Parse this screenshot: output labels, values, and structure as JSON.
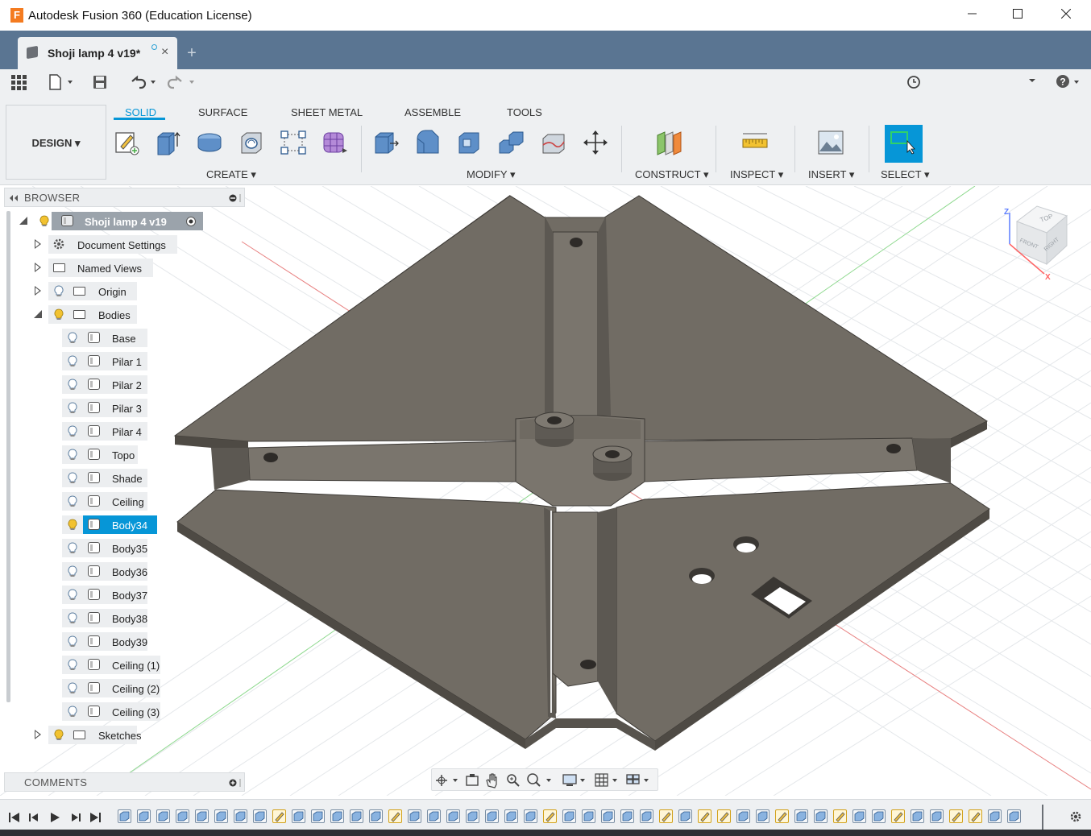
{
  "window": {
    "title": "Autodesk Fusion 360 (Education License)",
    "minimize_icon": "minimize-icon",
    "maximize_icon": "maximize-icon",
    "close_icon": "close-icon"
  },
  "document_tab": {
    "name": "Shoji lamp 4 v19*",
    "close_glyph": "×",
    "new_tab_glyph": "+"
  },
  "workspace": {
    "mode_label": "DESIGN",
    "tabs": [
      {
        "label": "SOLID",
        "active": true
      },
      {
        "label": "SURFACE",
        "active": false
      },
      {
        "label": "SHEET METAL",
        "active": false
      },
      {
        "label": "ASSEMBLE",
        "active": false
      },
      {
        "label": "TOOLS",
        "active": false
      }
    ],
    "groups": {
      "create": "CREATE",
      "modify": "MODIFY",
      "construct": "CONSTRUCT",
      "inspect": "INSPECT",
      "insert": "INSERT",
      "select": "SELECT"
    }
  },
  "browser": {
    "title": "BROWSER",
    "root": "Shoji lamp 4 v19",
    "items": [
      {
        "label": "Document Settings"
      },
      {
        "label": "Named Views"
      },
      {
        "label": "Origin"
      },
      {
        "label": "Bodies"
      },
      {
        "label": "Base"
      },
      {
        "label": "Pilar 1"
      },
      {
        "label": "Pilar 2"
      },
      {
        "label": "Pilar 3"
      },
      {
        "label": "Pilar 4"
      },
      {
        "label": "Topo"
      },
      {
        "label": "Shade"
      },
      {
        "label": "Ceiling"
      },
      {
        "label": "Body34"
      },
      {
        "label": "Body35"
      },
      {
        "label": "Body36"
      },
      {
        "label": "Body37"
      },
      {
        "label": "Body38"
      },
      {
        "label": "Body39"
      },
      {
        "label": "Ceiling (1)"
      },
      {
        "label": "Ceiling (2)"
      },
      {
        "label": "Ceiling (3)"
      },
      {
        "label": "Sketches"
      }
    ],
    "selected": "Body34"
  },
  "comments": {
    "title": "COMMENTS"
  },
  "viewcube": {
    "top": "TOP",
    "front": "FRONT",
    "right": "RIGHT",
    "axis_x": "X",
    "axis_z": "Z"
  },
  "colors": {
    "accent": "#0696d7",
    "tab_bar": "#5a7592",
    "model": "#6f6a62",
    "model_dark": "#4e4a44"
  }
}
